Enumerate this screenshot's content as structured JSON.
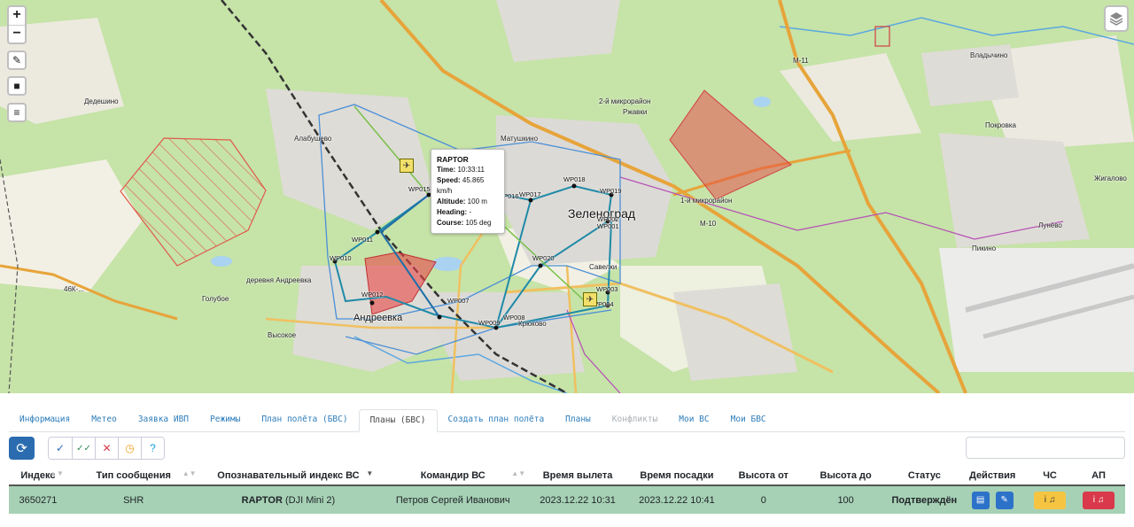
{
  "map": {
    "zoom_in": "+",
    "zoom_out": "−",
    "draw_icon": "✎",
    "stop_icon": "■",
    "menu_icon": "≡",
    "layers_icon": "layers-icon",
    "tooltip": {
      "title": "RAPTOR",
      "time_label": "Time:",
      "time_value": "10:33:11",
      "speed_label": "Speed:",
      "speed_value": "45.865 km/h",
      "altitude_label": "Altitude:",
      "altitude_value": "100 m",
      "heading_label": "Heading:",
      "heading_value": "-",
      "course_label": "Course:",
      "course_value": "105 deg"
    },
    "labels": {
      "zelenograd": "Зеленоград",
      "andreevka": "Андреевка",
      "alabushevo": "Алабушево",
      "matushkino": "Матушкино",
      "dedeshino": "Дедешино",
      "savelki": "Савелки",
      "kryukovo": "Крюково",
      "vysokoe": "Высокое",
      "golubo": "Голубое",
      "andreevka_village": "деревня Андреевка",
      "rzhavki": "Ржавки",
      "mikro1": "2-й микрорайон",
      "mikro2": "1-й микрорайон",
      "vladychino": "Владычино",
      "pokrovka": "Покровка",
      "zhigalovo": "Жигалово",
      "lunevo": "Лунёво",
      "pikino": "Пикино",
      "m11": "M-11",
      "m10": "M-10",
      "km46": "46К-..."
    },
    "waypoints": [
      "WP018",
      "WP019",
      "WP016",
      "WP017",
      "WP015",
      "WP002",
      "WP001",
      "WP020",
      "WP011",
      "WP010",
      "WP012",
      "WP007",
      "WP008",
      "WP003",
      "WP004",
      "WP009"
    ]
  },
  "tabs": [
    {
      "label": "Информация"
    },
    {
      "label": "Метео"
    },
    {
      "label": "Заявка ИВП"
    },
    {
      "label": "Режимы"
    },
    {
      "label": "План полёта (БВС)"
    },
    {
      "label": "Планы (БВС)"
    },
    {
      "label": "Создать план полёта"
    },
    {
      "label": "Планы"
    },
    {
      "label": "Конфликты"
    },
    {
      "label": "Мои ВС"
    },
    {
      "label": "Мои БВС"
    }
  ],
  "toolbar": {
    "refresh_icon": "⟳",
    "filters": [
      "✓",
      "✓✓",
      "✕",
      "◷",
      "?"
    ],
    "search_placeholder": ""
  },
  "table": {
    "headers": [
      "Индекс",
      "Тип сообщения",
      "Опознавательный индекс ВС",
      "Командир ВС",
      "Время вылета",
      "Время посадки",
      "Высота от",
      "Высота до",
      "Статус",
      "Действия",
      "ЧС",
      "АП"
    ],
    "row": {
      "index": "3650271",
      "msg_type": "SHR",
      "callsign": "RAPTOR",
      "aircraft": "(DJI Mini 2)",
      "commander": "Петров Сергей Иванович",
      "departure": "2023.12.22 10:31",
      "landing": "2023.12.22 10:41",
      "alt_from": "0",
      "alt_to": "100",
      "status": "Подтверждён"
    }
  }
}
